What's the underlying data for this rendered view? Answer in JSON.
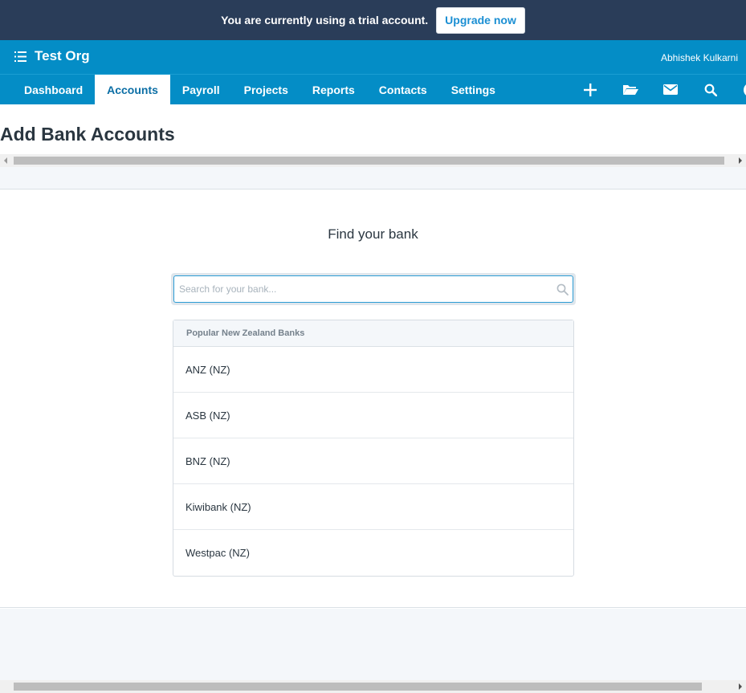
{
  "trial_banner": {
    "message": "You are currently using a trial account.",
    "upgrade_label": "Upgrade now"
  },
  "header": {
    "org_name": "Test Org",
    "user_name": "Abhishek Kulkarni",
    "menu_icon": "list-menu-icon"
  },
  "nav": {
    "tabs": [
      {
        "label": "Dashboard",
        "active": false
      },
      {
        "label": "Accounts",
        "active": true
      },
      {
        "label": "Payroll",
        "active": false
      },
      {
        "label": "Projects",
        "active": false
      },
      {
        "label": "Reports",
        "active": false
      },
      {
        "label": "Contacts",
        "active": false
      },
      {
        "label": "Settings",
        "active": false
      }
    ],
    "icons": [
      "plus-icon",
      "folder-icon",
      "mail-icon",
      "search-icon",
      "help-icon"
    ]
  },
  "page": {
    "title": "Add Bank Accounts"
  },
  "finder": {
    "title": "Find your bank",
    "search_placeholder": "Search for your bank...",
    "search_value": "",
    "list_header": "Popular New Zealand Banks",
    "banks": [
      "ANZ (NZ)",
      "ASB (NZ)",
      "BNZ (NZ)",
      "Kiwibank (NZ)",
      "Westpac (NZ)"
    ]
  },
  "colors": {
    "banner_bg": "#2a3d59",
    "header_bg": "#048dc6",
    "accent": "#1b8fd3",
    "title_text": "#2a3640"
  }
}
